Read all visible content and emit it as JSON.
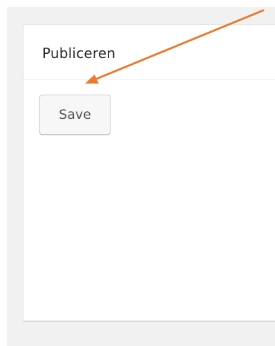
{
  "postbox": {
    "title": "Publiceren",
    "save_label": "Save"
  },
  "colors": {
    "annotation_arrow": "#e87c2f",
    "page_background": "#f1f1f1",
    "panel_background": "#ffffff"
  }
}
